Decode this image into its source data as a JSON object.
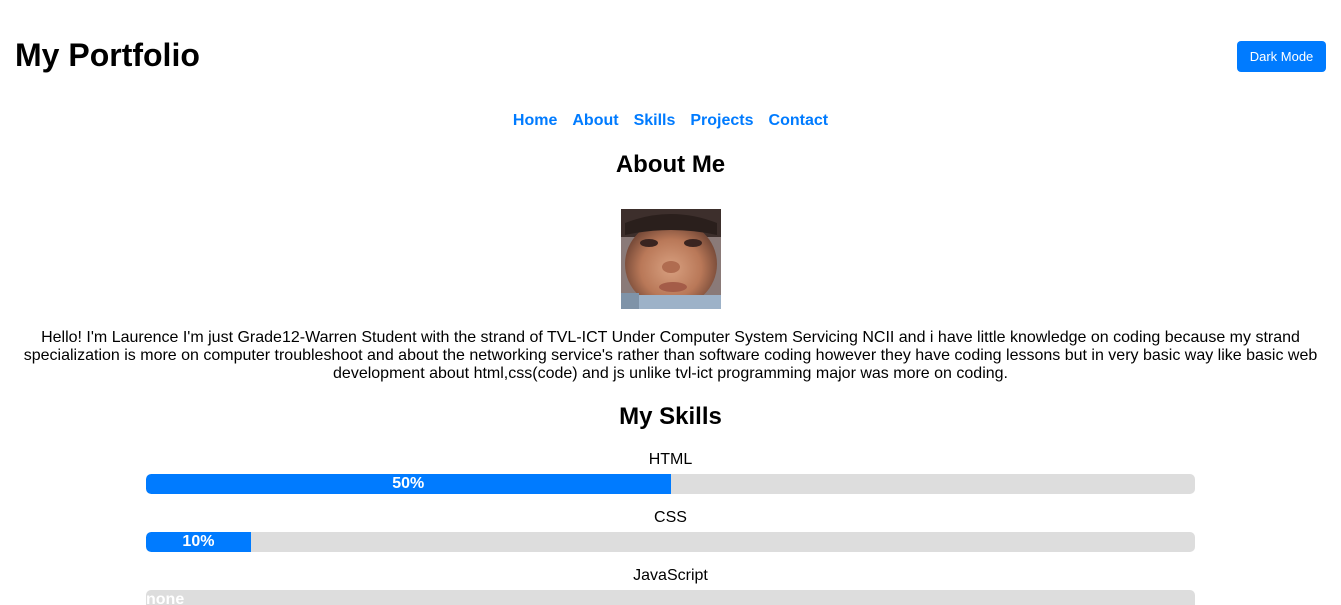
{
  "header": {
    "title": "My Portfolio",
    "dark_mode_label": "Dark Mode"
  },
  "nav": {
    "items": [
      "Home",
      "About",
      "Skills",
      "Projects",
      "Contact"
    ]
  },
  "about": {
    "title": "About Me",
    "photo_alt": "Profile photo",
    "bio": "Hello! I'm Laurence I'm just Grade12-Warren Student with the strand of TVL-ICT Under Computer System Servicing NCII and i have little knowledge on coding because my strand specialization is more on computer troubleshoot and about the networking service's rather than software coding however they have coding lessons but in very basic way like basic web development about html,css(code) and js unlike tvl-ict programming major was more on coding."
  },
  "skills": {
    "title": "My Skills",
    "items": [
      {
        "name": "HTML",
        "label": "50%",
        "level": 0.5
      },
      {
        "name": "CSS",
        "label": "10%",
        "level": 0.1
      },
      {
        "name": "JavaScript",
        "label": "none",
        "level": 0
      }
    ]
  },
  "colors": {
    "accent": "#007bff",
    "track": "#dddddd"
  },
  "icons": {
    "photo": "profile-photo"
  }
}
